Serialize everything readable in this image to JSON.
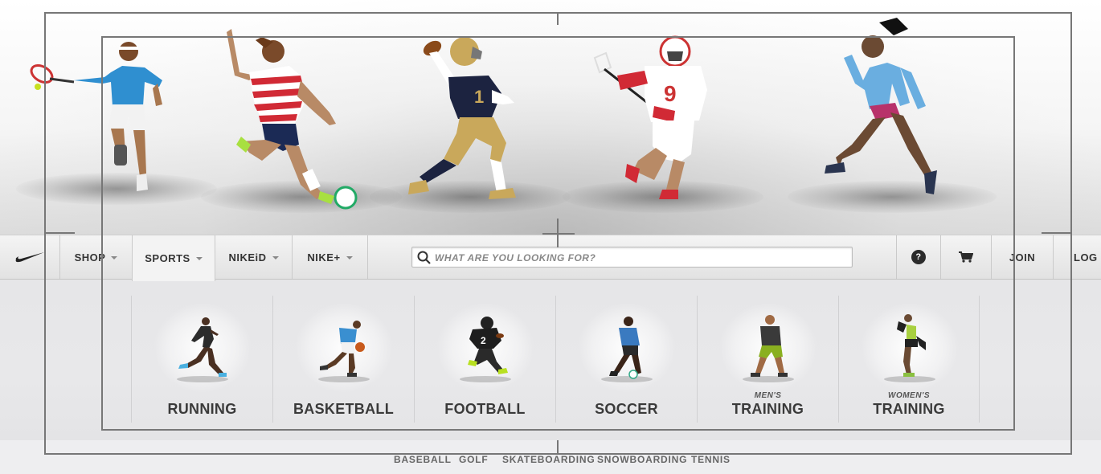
{
  "nav": {
    "shop_label": "SHOP",
    "sports_label": "SPORTS",
    "nikeid_label": "NIKEiD",
    "nikeplus_label": "NIKE+",
    "join_label": "JOIN",
    "login_label": "LOG IN",
    "help_glyph": "?"
  },
  "search": {
    "placeholder": "WHAT ARE YOU LOOKING FOR?"
  },
  "sports": [
    {
      "pre": "",
      "label": "RUNNING"
    },
    {
      "pre": "",
      "label": "BASKETBALL"
    },
    {
      "pre": "",
      "label": "FOOTBALL"
    },
    {
      "pre": "",
      "label": "SOCCER"
    },
    {
      "pre": "MEN'S",
      "label": "TRAINING"
    },
    {
      "pre": "WOMEN'S",
      "label": "TRAINING"
    }
  ],
  "more_sports": [
    "BASEBALL",
    "GOLF",
    "SKATEBOARDING",
    "SNOWBOARDING",
    "TENNIS"
  ],
  "colors": {
    "nav_text": "#333333",
    "frame": "#777777",
    "panel_bg": "#e6e6e8"
  },
  "icons": [
    "nike-swoosh-icon",
    "chevron-down-icon",
    "search-icon",
    "help-icon",
    "cart-icon"
  ]
}
